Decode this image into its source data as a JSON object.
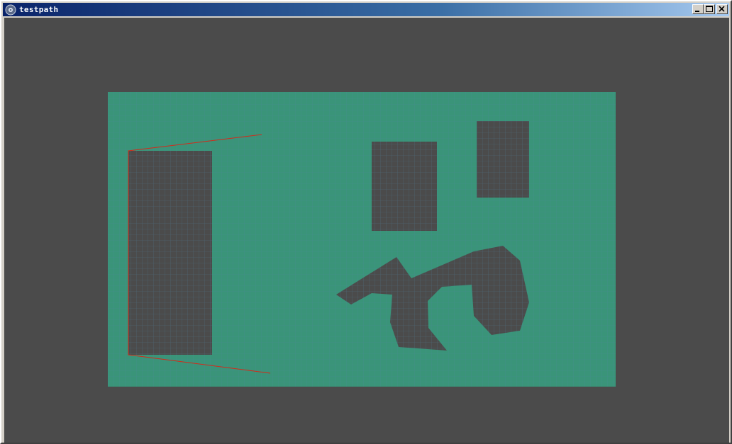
{
  "window": {
    "title": "testpath",
    "icons": {
      "app": "app-gear-icon",
      "minimize": "minimize-icon",
      "maximize": "maximize-icon",
      "close": "close-icon"
    }
  },
  "scene": {
    "colors": {
      "background": "#4b4b4b",
      "floor": "#3a9479",
      "grid": "#4f86a2",
      "obstacle": "#4b4b4b",
      "path": "#d42a1a"
    }
  }
}
